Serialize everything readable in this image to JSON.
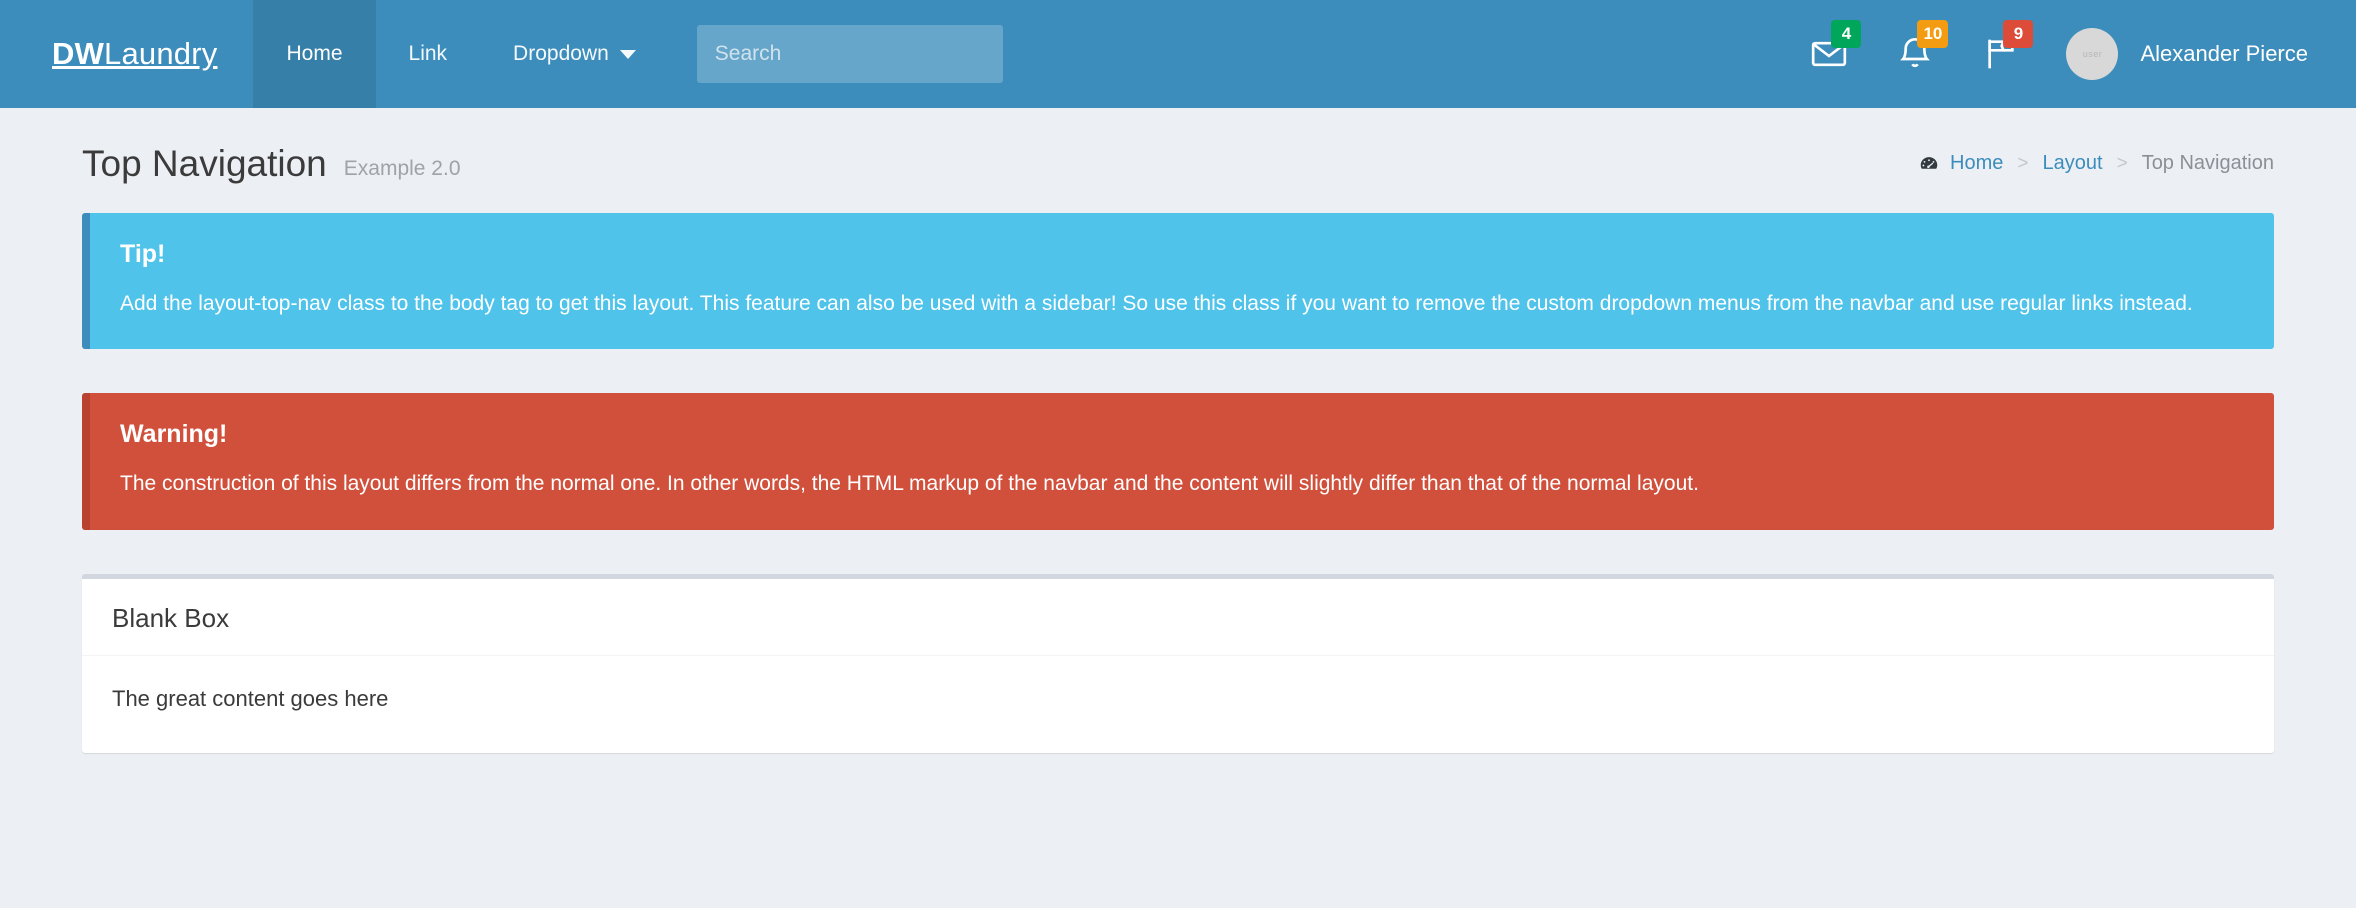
{
  "navbar": {
    "brand_bold": "DW",
    "brand_light": "Laundry",
    "links": [
      {
        "label": "Home",
        "active": true,
        "has_caret": false
      },
      {
        "label": "Link",
        "active": false,
        "has_caret": false
      },
      {
        "label": "Dropdown",
        "active": false,
        "has_caret": true
      }
    ],
    "search": {
      "placeholder": "Search",
      "value": ""
    },
    "icons": [
      {
        "name": "envelope-icon",
        "badge": "4",
        "badge_color": "#00a65a"
      },
      {
        "name": "bell-icon",
        "badge": "10",
        "badge_color": "#f39c12"
      },
      {
        "name": "flag-icon",
        "badge": "9",
        "badge_color": "#dd4b39"
      }
    ],
    "user": {
      "name": "Alexander Pierce",
      "avatar_initials": "user"
    },
    "bg_color": "#3c8dbc",
    "active_bg_color": "#367fa9"
  },
  "content_header": {
    "title": "Top Navigation",
    "subtitle": "Example 2.0",
    "breadcrumb": {
      "icon": "tachometer-icon",
      "items": [
        {
          "label": "Home",
          "current": false
        },
        {
          "label": "Layout",
          "current": false
        },
        {
          "label": "Top Navigation",
          "current": true
        }
      ],
      "separator": ">"
    }
  },
  "callouts": [
    {
      "type": "info",
      "heading": "Tip!",
      "text": "Add the layout-top-nav class to the body tag to get this layout. This feature can also be used with a sidebar! So use this class if you want to remove the custom dropdown menus from the navbar and use regular links instead.",
      "bg_color": "#4fc3ea",
      "border_color": "#3c8dbc"
    },
    {
      "type": "danger",
      "heading": "Warning!",
      "text": "The construction of this layout differs from the normal one. In other words, the HTML markup of the navbar and the content will slightly differ than that of the normal layout.",
      "bg_color": "#d0503c",
      "border_color": "#b8422f"
    }
  ],
  "box": {
    "title": "Blank Box",
    "body": "The great content goes here"
  },
  "page": {
    "background_color": "#ecf0f5"
  }
}
